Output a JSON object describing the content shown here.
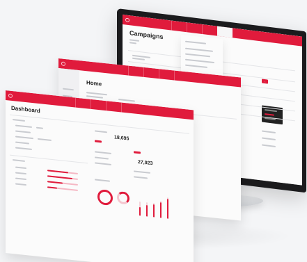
{
  "campaigns": {
    "title": "Campaigns",
    "button_label": "..."
  },
  "home": {
    "title": "Home"
  },
  "dashboard": {
    "title": "Dashboard",
    "kpi_1": "18,695",
    "kpi_2": "27,923"
  },
  "colors": {
    "accent": "#e01b3c",
    "accent_light": "#f5b8c4",
    "background": "#f4f5f7",
    "monitor_bezel": "#1b1b1d"
  }
}
